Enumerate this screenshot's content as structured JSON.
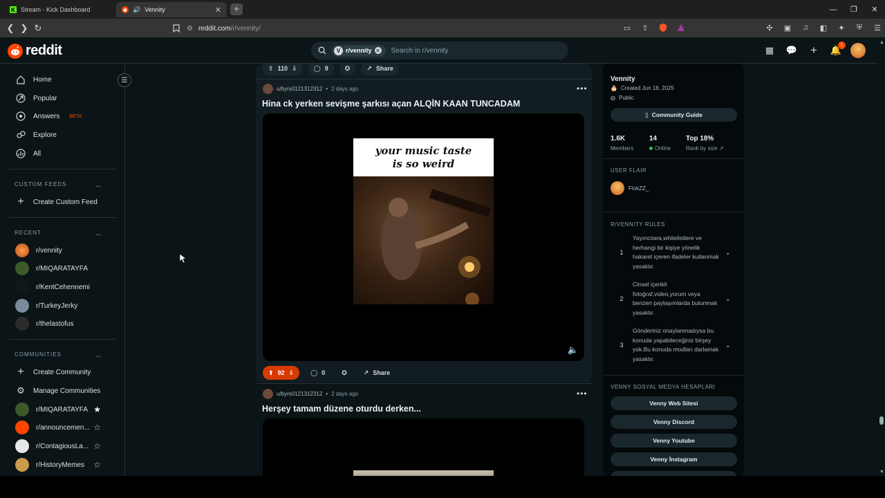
{
  "browser": {
    "tabs": [
      {
        "title": "Stream - Kick Dashboard",
        "active": false
      },
      {
        "title": "Vennity",
        "active": true
      }
    ],
    "url_domain": "reddit.com",
    "url_path": "/r/vennity/",
    "notification_count": "1"
  },
  "header": {
    "logo_text": "reddit",
    "search_chip": "r/vennity",
    "search_placeholder": "Search in r/vennity",
    "notification_badge": "1"
  },
  "leftnav": {
    "main": [
      {
        "label": "Home",
        "icon": "home-icon"
      },
      {
        "label": "Popular",
        "icon": "popular-icon"
      },
      {
        "label": "Answers",
        "icon": "answers-icon",
        "badge": "BETA"
      },
      {
        "label": "Explore",
        "icon": "explore-icon"
      },
      {
        "label": "All",
        "icon": "all-icon"
      }
    ],
    "custom_feeds_title": "CUSTOM FEEDS",
    "create_custom_feed": "Create Custom Feed",
    "recent_title": "RECENT",
    "recent": [
      "r/vennity",
      "r/MIQARATAYFA",
      "r/KentCehennemi",
      "r/TurkeyJerky",
      "r/thelastofus"
    ],
    "communities_title": "COMMUNITIES",
    "create_community": "Create Community",
    "manage_communities": "Manage Communities",
    "communities": [
      "r/MIQARATAYFA",
      "r/announcemen...",
      "r/ContagiousLa...",
      "r/HistoryMemes"
    ]
  },
  "feed": {
    "prev_post": {
      "votes": "110",
      "comments": "9",
      "share": "Share"
    },
    "post1": {
      "author": "u/byrs0121312312",
      "time": "2 days ago",
      "title": "Hina ck yerken sevişme şarkısı açan ALQİN KAAN TUNCADAM",
      "caption_line1": "your music taste",
      "caption_line2": "is so weird",
      "votes": "92",
      "comments": "0",
      "share": "Share"
    },
    "post2": {
      "author": "u/byrs0121312312",
      "time": "2 days ago",
      "title": "Herşey tamam düzene oturdu derken..."
    }
  },
  "sidebar": {
    "community_name": "Vennity",
    "created": "Created Jun 18, 2025",
    "visibility": "Public",
    "guide_button": "Community Guide",
    "members_value": "1.6K",
    "members_label": "Members",
    "online_value": "14",
    "online_label": "Online",
    "rank_value": "Top 18%",
    "rank_label": "Rank by size",
    "user_flair_title": "USER FLAIR",
    "user_flair_name": "FlokZZ_",
    "rules_title": "R/VENNITY RULES",
    "rules": [
      {
        "num": "1",
        "text": "Yayıncılara,whitelistlere ve herhangi bir kişiye yönelik hakaret içeren ifadeler kullanmak yasaktır."
      },
      {
        "num": "2",
        "text": "Cinsel içerikli fotoğraf,video,yorum veya benzeri paylaşımlarda bulunmak yasaktır."
      },
      {
        "num": "3",
        "text": "Gönderiniz onaylanmadıysa bu konuda yapabileceğiniz birşey yok.Bu konuda modları darlamak yasaktır."
      }
    ],
    "social_title": "VENNY SOSYAL MEDYA HESAPLARI",
    "social_links": [
      "Venny Web Sitesi",
      "Venny Discord",
      "Venny Youtube",
      "Venny İnstagram"
    ]
  },
  "colors": {
    "accent": "#ff4500",
    "upvoted": "#d93a00",
    "bg": "#0b1416"
  }
}
